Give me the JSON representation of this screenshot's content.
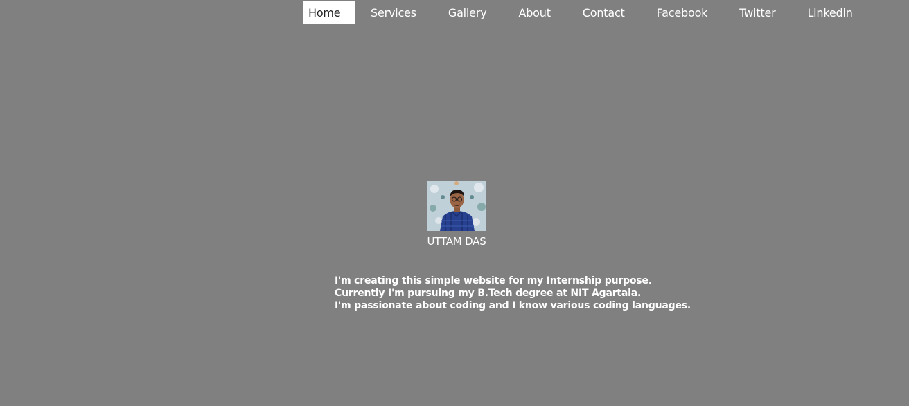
{
  "nav": {
    "items": [
      {
        "label": "Home",
        "active": true
      },
      {
        "label": "Services",
        "active": false
      },
      {
        "label": "Gallery",
        "active": false
      },
      {
        "label": "About",
        "active": false
      },
      {
        "label": "Contact",
        "active": false
      },
      {
        "label": "Facebook",
        "active": false
      },
      {
        "label": "Twitter",
        "active": false
      },
      {
        "label": "Linkedin",
        "active": false
      }
    ]
  },
  "profile": {
    "name": "UTTAM DAS"
  },
  "bio": {
    "lines": [
      "I'm creating this simple website for my Internship purpose.",
      "Currently I'm pursuing my B.Tech degree at NIT Agartala.",
      "I'm passionate about coding and I know various coding languages."
    ]
  },
  "colors": {
    "background": "#808080",
    "nav_active_bg": "#ffffff",
    "text": "#ffffff"
  }
}
